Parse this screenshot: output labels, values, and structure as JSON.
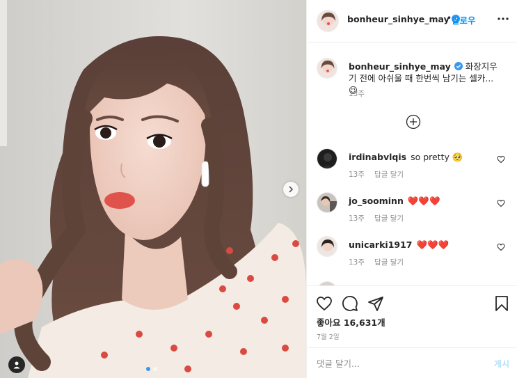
{
  "post": {
    "author": "bonheur_sinhye_may",
    "verified": true,
    "header_separator": "•",
    "follow_label": "팔로우",
    "caption": {
      "username": "bonheur_sinhye_may",
      "text": "화장지우기 전에 아쉬울 때 한번씩 남기는 셀카...😉",
      "time": "13주"
    },
    "comments": [
      {
        "username": "irdinabvlqis",
        "text": "so pretty 🥺",
        "time": "13주",
        "reply_label": "답글 달기"
      },
      {
        "username": "jo_soominn",
        "text": "❤️❤️❤️",
        "time": "13주",
        "reply_label": "답글 달기"
      },
      {
        "username": "unicarki1917",
        "text": "❤️❤️❤️",
        "time": "13주",
        "reply_label": "답글 달기"
      }
    ],
    "likes_text": "좋아요 16,631개",
    "date_text": "7월 2일",
    "add_comment_placeholder": "댓글 달기...",
    "post_button_label": "게시",
    "carousel": {
      "total": 2,
      "current": 1
    }
  },
  "icons": {
    "more": "more-horizontal-icon",
    "load_more": "plus-circle-icon",
    "like": "heart-outline-icon",
    "comment": "comment-bubble-icon",
    "share": "paper-plane-icon",
    "save": "bookmark-icon",
    "next": "chevron-right-icon",
    "tag": "user-tag-icon",
    "verified": "verified-badge-icon"
  },
  "colors": {
    "accent": "#0095f6",
    "verified_blue": "#3897f0",
    "post_disabled": "#b2dffc",
    "muted_text": "#8e8e8e"
  }
}
